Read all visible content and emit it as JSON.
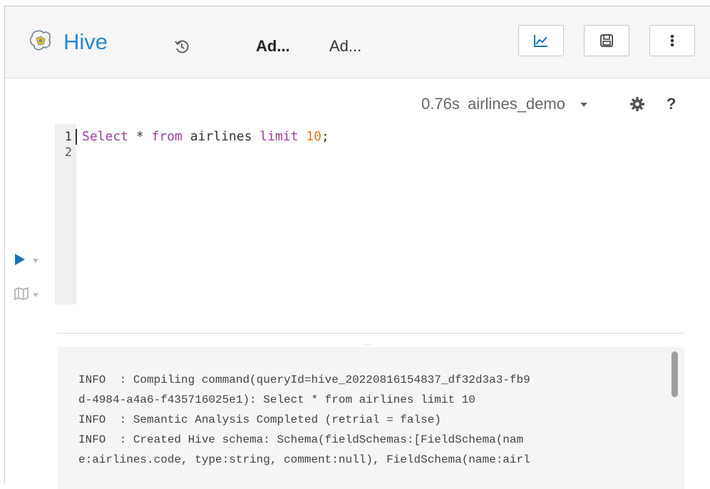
{
  "header": {
    "app_title": "Hive",
    "tabs": [
      {
        "label": "Ad...",
        "active": true
      },
      {
        "label": "Ad...",
        "active": false
      }
    ],
    "icons": {
      "logo": "hive-logo-icon",
      "history": "history-icon",
      "chart": "chart-icon",
      "save": "save-icon",
      "more": "more-vertical-icon"
    },
    "colors": {
      "brand": "#2a88c8"
    }
  },
  "editor": {
    "meta": {
      "duration": "0.76s",
      "database": "airlines_demo",
      "dropdown_icon": "caret-down-icon",
      "settings_icon": "gear-icon",
      "help": "?"
    },
    "line_numbers": [
      "1",
      "2"
    ],
    "code": {
      "kw1": "Select",
      "star": " * ",
      "kw2": "from",
      "table": " airlines ",
      "kw3": "limit",
      "space": " ",
      "number": "10",
      "end": ";"
    },
    "actions": {
      "run_icon": "play-icon",
      "explain_icon": "map-icon"
    },
    "colors": {
      "keyword": "#9b3fa3",
      "number": "#e8731a",
      "run": "#1a73b8"
    }
  },
  "logs": {
    "lines": [
      "INFO  : Compiling command(queryId=hive_20220816154837_df32d3a3-fb9",
      "d-4984-a4a6-f435716025e1): Select * from airlines limit 10",
      "INFO  : Semantic Analysis Completed (retrial = false)",
      "INFO  : Created Hive schema: Schema(fieldSchemas:[FieldSchema(nam",
      "e:airlines.code, type:string, comment:null), FieldSchema(name:airl"
    ]
  }
}
